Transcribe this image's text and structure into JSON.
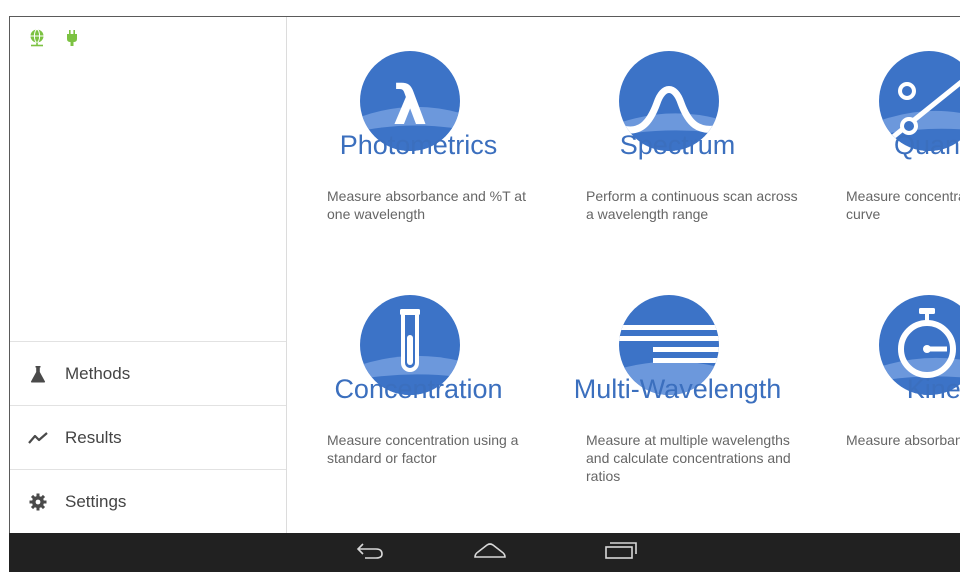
{
  "sidebar": {
    "status_icons": [
      "network-globe-icon",
      "power-plug-icon"
    ],
    "status_color": "#7cc242",
    "items": [
      {
        "label": "Methods",
        "icon": "flask-icon"
      },
      {
        "label": "Results",
        "icon": "chart-line-icon"
      },
      {
        "label": "Settings",
        "icon": "gear-icon"
      }
    ]
  },
  "tiles": [
    {
      "title": "Photometrics",
      "description": "Measure absorbance and %T at one wavelength",
      "icon": "lambda-icon"
    },
    {
      "title": "Spectrum",
      "description": "Perform a continuous scan across a wavelength range",
      "icon": "spectrum-wave-icon"
    },
    {
      "title": "Quantit",
      "description": "Measure concentra standard curve",
      "icon": "standard-curve-icon"
    },
    {
      "title": "Concentration",
      "description": "Measure concentration using a standard or factor",
      "icon": "test-tube-icon"
    },
    {
      "title": "Multi-Wavelength",
      "description": "Measure at multiple wavelengths and calculate concentrations and ratios",
      "icon": "multi-lines-icon"
    },
    {
      "title": "Kinet",
      "description": "Measure absorban time",
      "icon": "stopwatch-icon"
    }
  ],
  "accent_color": "#3b6fbe",
  "navbar": {
    "buttons": [
      "back-icon",
      "home-icon",
      "recent-apps-icon"
    ]
  }
}
